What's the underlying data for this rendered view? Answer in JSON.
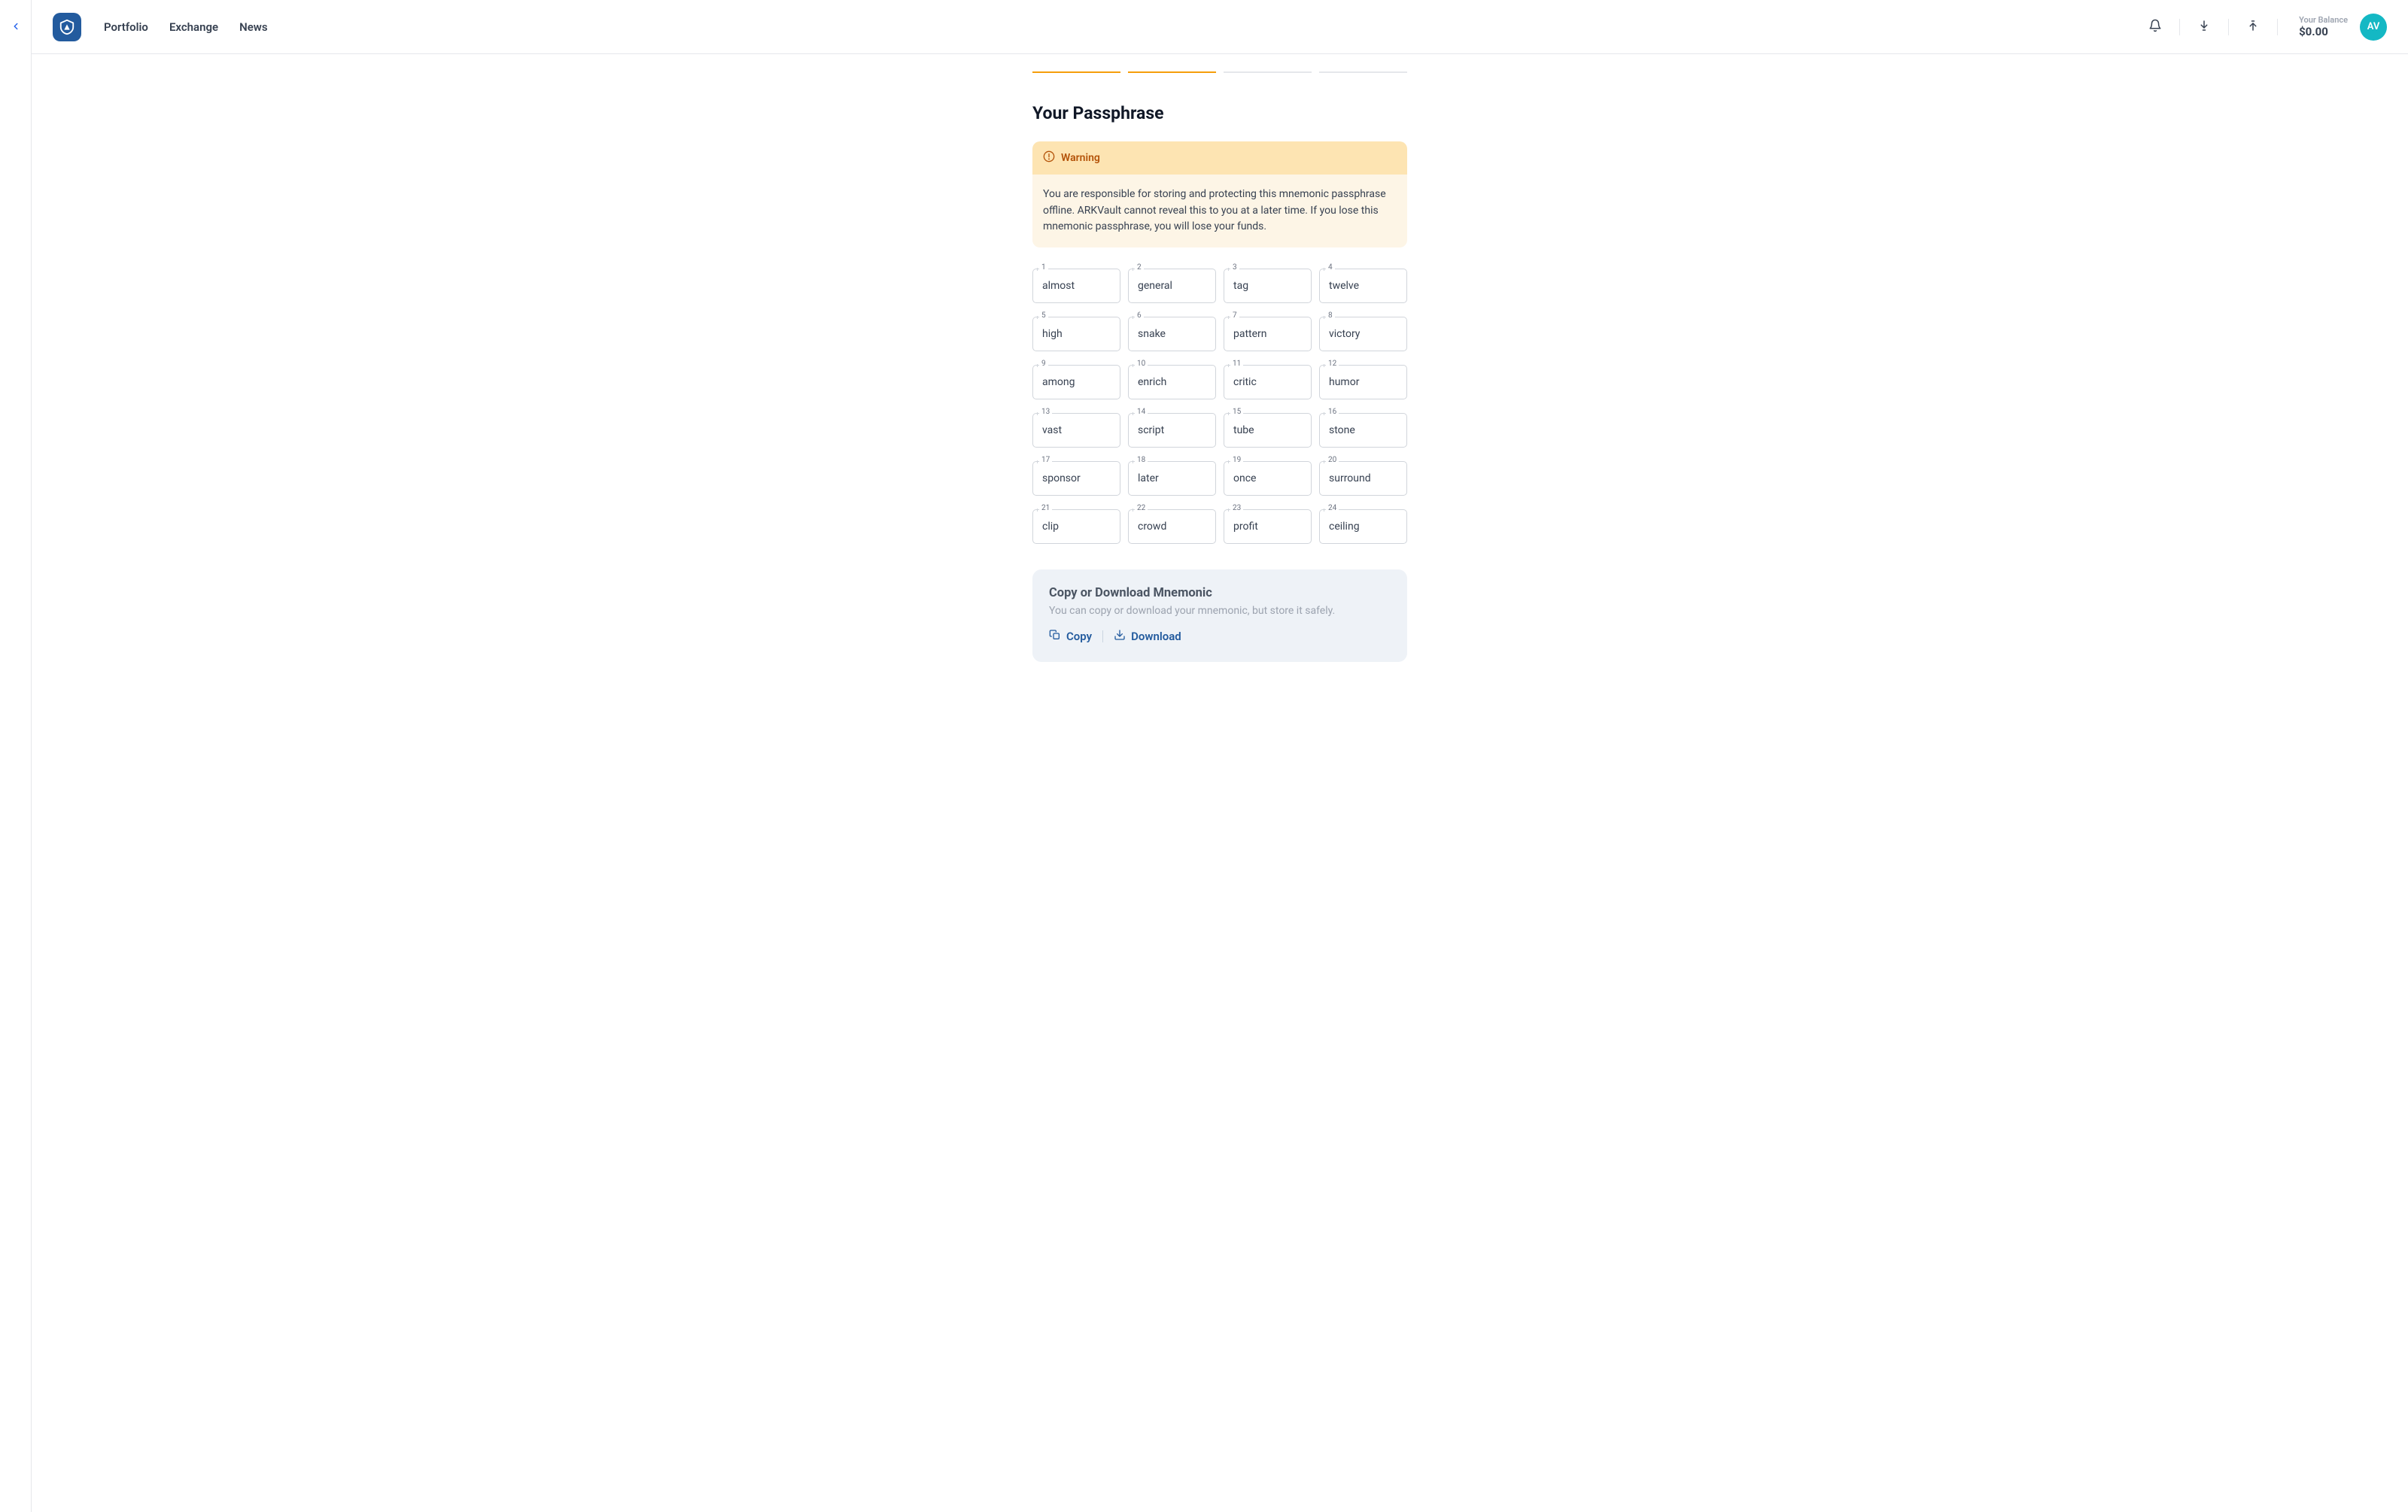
{
  "nav": {
    "portfolio": "Portfolio",
    "exchange": "Exchange",
    "news": "News"
  },
  "header": {
    "balance_label": "Your Balance",
    "balance_value": "$0.00",
    "avatar": "AV"
  },
  "stepper": {
    "total": 4,
    "active": 2
  },
  "page": {
    "title": "Your Passphrase"
  },
  "warning": {
    "label": "Warning",
    "body": "You are responsible for storing and protecting this mnemonic passphrase offline. ARKVault cannot reveal this to you at a later time. If you lose this mnemonic passphrase, you will lose your funds."
  },
  "mnemonic": [
    "almost",
    "general",
    "tag",
    "twelve",
    "high",
    "snake",
    "pattern",
    "victory",
    "among",
    "enrich",
    "critic",
    "humor",
    "vast",
    "script",
    "tube",
    "stone",
    "sponsor",
    "later",
    "once",
    "surround",
    "clip",
    "crowd",
    "profit",
    "ceiling"
  ],
  "copy": {
    "title": "Copy or Download Mnemonic",
    "sub": "You can copy or download your mnemonic, but store it safely.",
    "copy_label": "Copy",
    "download_label": "Download"
  }
}
